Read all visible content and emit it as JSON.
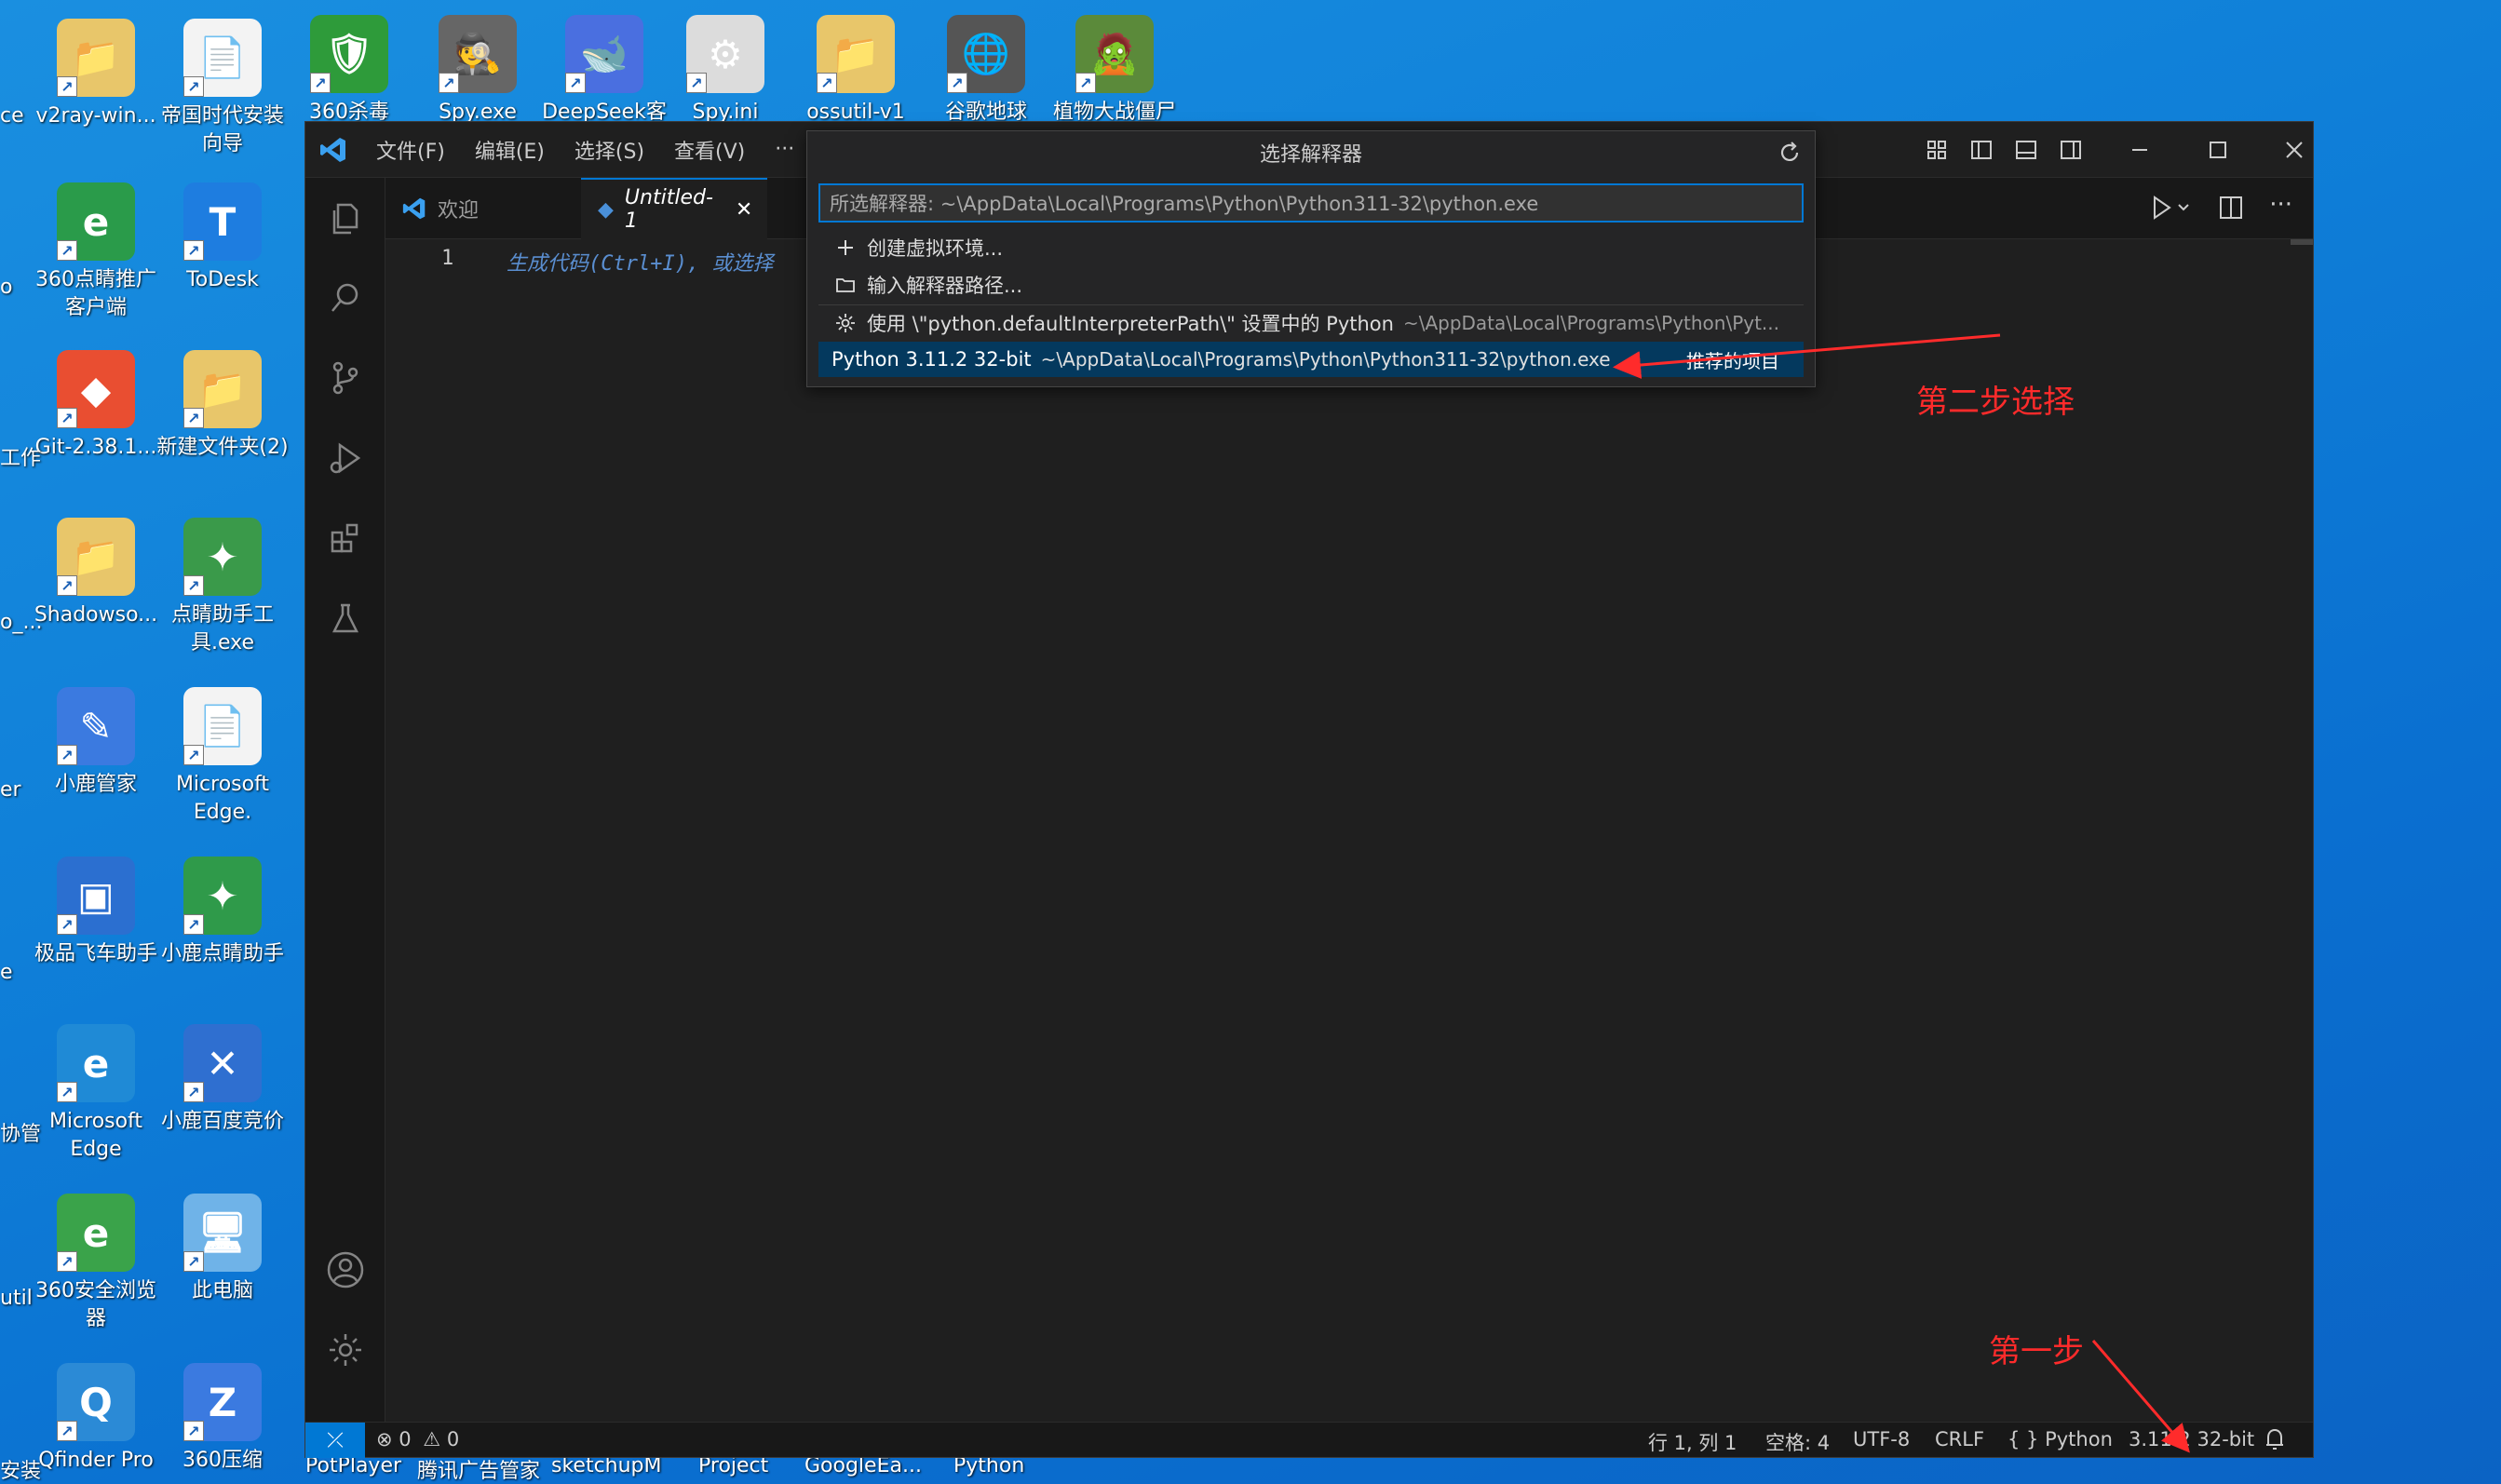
{
  "desktop": {
    "icons": [
      {
        "label": "v2ray-win...",
        "glyph": "📁",
        "color": "#e8c66a"
      },
      {
        "label": "帝国时代安装向导",
        "glyph": "📄",
        "color": "#f3f3f3"
      },
      {
        "label": "360杀毒",
        "glyph": "🛡",
        "color": "#2e9b3a"
      },
      {
        "label": "Spy.exe",
        "glyph": "🕵",
        "color": "#666"
      },
      {
        "label": "DeepSeek客",
        "glyph": "🐋",
        "color": "#4a6fe0"
      },
      {
        "label": "Spy.ini",
        "glyph": "⚙",
        "color": "#dcdcdc"
      },
      {
        "label": "ossutil-v1",
        "glyph": "📁",
        "color": "#e8c66a"
      },
      {
        "label": "谷歌地球",
        "glyph": "🌐",
        "color": "#555"
      },
      {
        "label": "植物大战僵尸",
        "glyph": "🧟",
        "color": "#5b8a3a"
      },
      {
        "label": "360点睛推广客户端",
        "glyph": "e",
        "color": "#2a9b4a"
      },
      {
        "label": "ToDesk",
        "glyph": "T",
        "color": "#1e7de0"
      },
      {
        "label": "Git-2.38.1...",
        "glyph": "◆",
        "color": "#e94e31"
      },
      {
        "label": "新建文件夹(2)",
        "glyph": "📁",
        "color": "#e8c66a"
      },
      {
        "label": "Shadowso...",
        "glyph": "📁",
        "color": "#e8c66a"
      },
      {
        "label": "点睛助手工具.exe",
        "glyph": "✦",
        "color": "#3a9a4a"
      },
      {
        "label": "小鹿管家",
        "glyph": "✎",
        "color": "#3b7ae0"
      },
      {
        "label": "Microsoft Edge.",
        "glyph": "📄",
        "color": "#f3f3f3"
      },
      {
        "label": "极品飞车助手",
        "glyph": "▣",
        "color": "#2b6fd0"
      },
      {
        "label": "小鹿点睛助手",
        "glyph": "✦",
        "color": "#2f9a4a"
      },
      {
        "label": "Microsoft Edge",
        "glyph": "e",
        "color": "#1f8ad6"
      },
      {
        "label": "小鹿百度竞价",
        "glyph": "✕",
        "color": "#2f6fd0"
      },
      {
        "label": "360安全浏览器",
        "glyph": "e",
        "color": "#3aa34a"
      },
      {
        "label": "此电脑",
        "glyph": "🖥",
        "color": "#6fb3e8"
      },
      {
        "label": "Qfinder Pro",
        "glyph": "Q",
        "color": "#2b8ad6"
      },
      {
        "label": "360压缩",
        "glyph": "Z",
        "color": "#3b7ae0"
      }
    ],
    "edge_labels": [
      "ce",
      "o",
      "工作",
      "o_...",
      "er",
      "e",
      "协管",
      "util",
      "安装"
    ],
    "taskbar_labels": [
      "PotPlayer",
      "腾讯广告管家",
      "sketchupM",
      "Project",
      "GoogleEa...",
      "Python"
    ]
  },
  "vscode": {
    "menu": [
      "文件(F)",
      "编辑(E)",
      "选择(S)",
      "查看(V)",
      "···"
    ],
    "window_title": "选择解释器",
    "tabs": [
      {
        "label": "欢迎"
      },
      {
        "label": "Untitled-1",
        "close": "✕"
      }
    ],
    "editor": {
      "line_number": "1",
      "ghost_text": "生成代码(Ctrl+I), 或选择"
    },
    "statusbar": {
      "errors": "0",
      "warnings": "0",
      "position": "行 1, 列 1",
      "spaces": "空格: 4",
      "encoding": "UTF-8",
      "eol": "CRLF",
      "language": "Python",
      "interpreter": "3.11.2 32-bit"
    }
  },
  "quickpick": {
    "title": "选择解释器",
    "input_value": "所选解释器: ~\\AppData\\Local\\Programs\\Python\\Python311-32\\python.exe",
    "items": [
      {
        "icon": "plus-icon",
        "label": "创建虚拟环境...",
        "desc": ""
      },
      {
        "icon": "folder-icon",
        "label": "输入解释器路径...",
        "desc": ""
      },
      {
        "icon": "gear-icon",
        "label": "使用 \\\"python.defaultInterpreterPath\\\" 设置中的 Python",
        "desc": "~\\AppData\\Local\\Programs\\Python\\Pyt..."
      },
      {
        "icon": "",
        "label": "Python 3.11.2 32-bit",
        "desc": "~\\AppData\\Local\\Programs\\Python\\Python311-32\\python.exe",
        "badge": "推荐的项目",
        "selected": true
      }
    ]
  },
  "annotations": {
    "step2": "第二步选择",
    "step1": "第一步",
    "color": "#ff2b2b"
  }
}
